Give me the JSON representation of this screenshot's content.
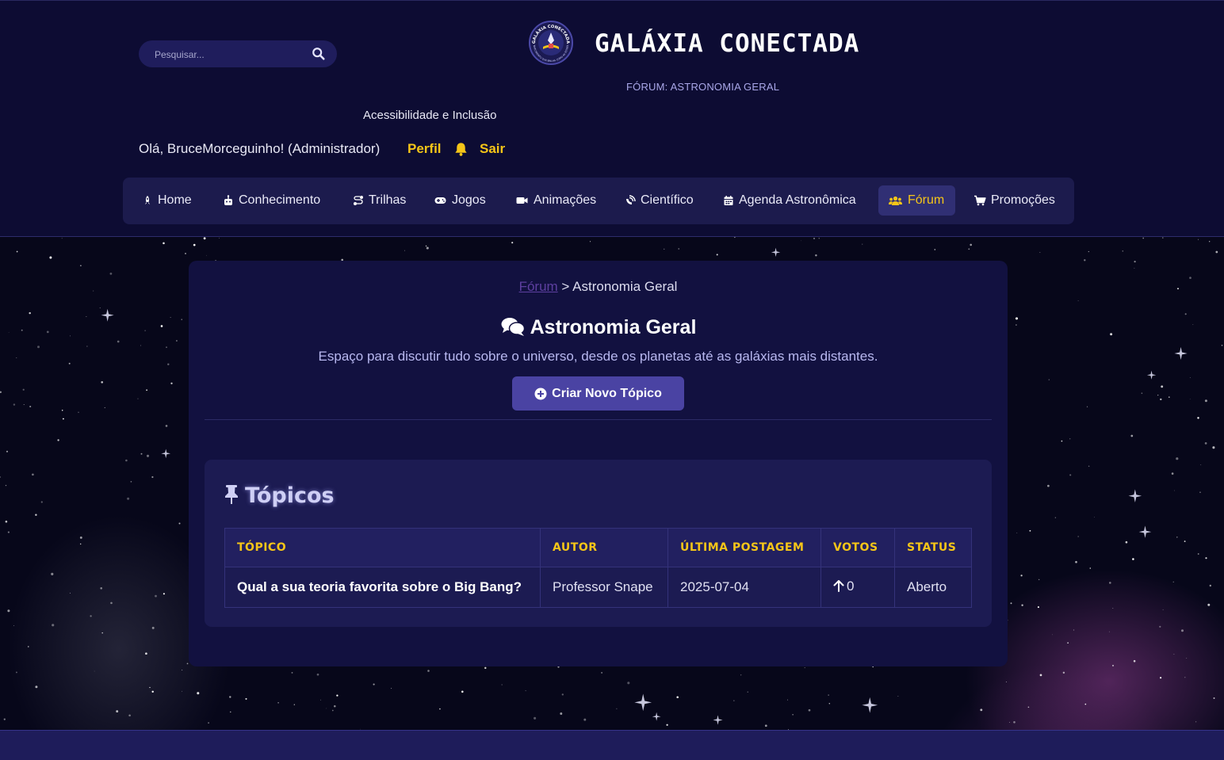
{
  "header": {
    "search": {
      "placeholder": "Pesquisar..."
    },
    "site_title": "GALÁXIA CONECTADA",
    "logo": {
      "text_top": "GALÁXIA CONECTADA",
      "text_bottom": "CONHECIMENTO QUE BRILHA COMO AS ESTRELAS"
    },
    "forum_subtitle": "FÓRUM: ASTRONOMIA GERAL",
    "accessibility_link": "Acessibilidade e Inclusão",
    "greeting": "Olá, BruceMorceguinho! (Administrador)",
    "profile_link": "Perfil",
    "logout_link": "Sair"
  },
  "nav": {
    "items": [
      {
        "label": "Home",
        "icon": "rocket-icon"
      },
      {
        "label": "Conhecimento",
        "icon": "robot-icon"
      },
      {
        "label": "Trilhas",
        "icon": "route-icon"
      },
      {
        "label": "Jogos",
        "icon": "gamepad-icon"
      },
      {
        "label": "Animações",
        "icon": "video-icon"
      },
      {
        "label": "Científico",
        "icon": "satellite-dish-icon"
      },
      {
        "label": "Agenda Astronômica",
        "icon": "calendar-icon"
      },
      {
        "label": "Fórum",
        "icon": "users-icon",
        "active": true
      },
      {
        "label": "Promoções",
        "icon": "cart-icon"
      }
    ]
  },
  "main": {
    "breadcrumb": {
      "root": "Fórum",
      "separator": ">",
      "current": "Astronomia Geral"
    },
    "forum_title": "Astronomia Geral",
    "forum_description": "Espaço para discutir tudo sobre o universo, desde os planetas até as galáxias mais distantes.",
    "new_topic_button": "Criar Novo Tópico",
    "topics": {
      "heading": "Tópicos",
      "columns": [
        "TÓPICO",
        "AUTOR",
        "ÚLTIMA POSTAGEM",
        "VOTOS",
        "STATUS"
      ],
      "rows": [
        {
          "title": "Qual a sua teoria favorita sobre o Big Bang?",
          "author": "Professor Snape",
          "last_post": "2025-07-04",
          "votes": "0",
          "status": "Aberto"
        }
      ]
    }
  },
  "colors": {
    "accent": "#f5c518",
    "header_bg": "#0d0c33",
    "nav_bg": "#1c1b4d",
    "button_bg": "#4a43a3",
    "card_bg": "#121140"
  }
}
